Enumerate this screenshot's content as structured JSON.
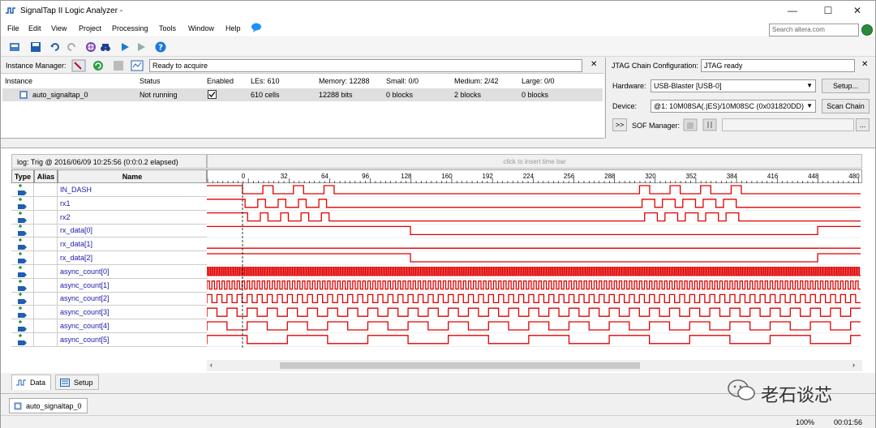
{
  "window": {
    "title": "SignalTap II Logic Analyzer -"
  },
  "menu": [
    "File",
    "Edit",
    "View",
    "Project",
    "Processing",
    "Tools",
    "Window",
    "Help"
  ],
  "search": {
    "placeholder": "Search altera.com"
  },
  "instance_manager": {
    "label": "Instance Manager:",
    "status": "Ready to acquire",
    "columns": [
      "Instance",
      "Status",
      "Enabled",
      "LEs: 610",
      "Memory: 12288",
      "Small: 0/0",
      "Medium: 2/42",
      "Large: 0/0"
    ],
    "row": {
      "instance": "auto_signaltap_0",
      "status": "Not running",
      "enabled": true,
      "les": "610 cells",
      "memory": "12288 bits",
      "small": "0 blocks",
      "medium": "2 blocks",
      "large": "0 blocks"
    }
  },
  "jtag": {
    "label": "JTAG Chain Configuration:",
    "status": "JTAG ready",
    "hardware_label": "Hardware:",
    "hardware_value": "USB-Blaster [USB-0]",
    "setup_button": "Setup...",
    "device_label": "Device:",
    "device_value": "@1: 10M08SA(.|ES)/10M08SC (0x031820DD)",
    "scan_button": "Scan Chain",
    "expand_button": ">>",
    "sof_label": "SOF Manager:",
    "browse_button": "..."
  },
  "waveform": {
    "log_header": "log: Trig @ 2016/06/09 10:25:56 (0:0:0.2 elapsed)",
    "insert_bar": "click to insert time bar",
    "columns": {
      "type": "Type",
      "alias": "Alias",
      "name": "Name"
    },
    "ruler_ticks": [
      "0",
      "32",
      "64",
      "96",
      "128",
      "160",
      "192",
      "224",
      "256",
      "288",
      "320",
      "352",
      "384",
      "416",
      "448",
      "480"
    ],
    "signals": [
      "IN_DASH",
      "rx1",
      "rx2",
      "rx_data[0]",
      "rx_data[1]",
      "rx_data[2]",
      "async_count[0]",
      "async_count[1]",
      "async_count[2]",
      "async_count[3]",
      "async_count[4]",
      "async_count[5]"
    ],
    "wave_color": "#e00000"
  },
  "tabs": [
    "Data",
    "Setup"
  ],
  "bottom_tab": "auto_signaltap_0",
  "watermark": "老石谈芯",
  "status": {
    "zoom": "100%",
    "time": "00:01:56"
  }
}
